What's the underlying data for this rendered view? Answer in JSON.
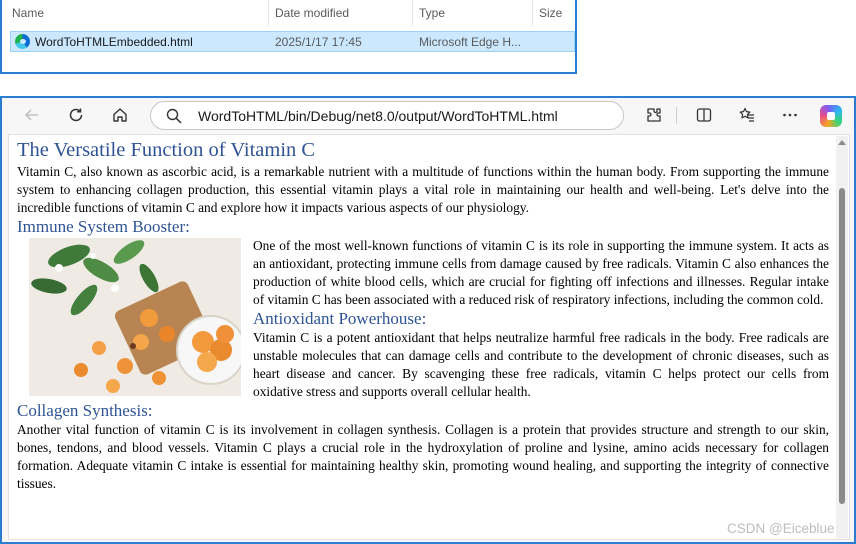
{
  "explorer": {
    "columns": {
      "name": "Name",
      "date": "Date modified",
      "type": "Type",
      "size": "Size"
    },
    "file": {
      "name": "WordToHTMLEmbedded.html",
      "date": "2025/1/17 17:45",
      "type": "Microsoft Edge H..."
    }
  },
  "browser": {
    "url": "WordToHTML/bin/Debug/net8.0/output/WordToHTML.html",
    "icons": [
      "back-icon",
      "refresh-icon",
      "home-icon",
      "search-icon",
      "extensions-icon",
      "split-screen-icon",
      "favorites-icon",
      "more-icon",
      "copilot-icon"
    ]
  },
  "doc": {
    "title": "The Versatile Function of Vitamin C",
    "intro": "Vitamin C, also known as ascorbic acid, is a remarkable nutrient with a multitude of functions within the human body. From supporting the immune system to enhancing collagen production, this essential vitamin plays a vital role in maintaining our health and well-being. Let's delve into the incredible functions of vitamin C and explore how it impacts various aspects of our physiology.",
    "h_immune": "Immune System Booster:",
    "p_immune": "One of the most well-known functions of vitamin C is its role in supporting the immune system. It acts as an antioxidant, protecting immune cells from damage caused by free radicals. Vitamin C also enhances the production of white blood cells, which are crucial for fighting off infections and illnesses. Regular intake of vitamin C has been associated with a reduced risk of respiratory infections, including the common cold.",
    "h_antioxidant": "Antioxidant Powerhouse:",
    "p_antioxidant": "Vitamin C is a potent antioxidant that helps neutralize harmful free radicals in the body. Free radicals are unstable molecules that can damage cells and contribute to the development of chronic diseases, such as heart disease and cancer. By scavenging these free radicals, vitamin C helps protect our cells from oxidative stress and supports overall cellular health.",
    "h_collagen": "Collagen Synthesis:",
    "p_collagen": "Another vital function of vitamin C is its involvement in collagen synthesis. Collagen is a protein that provides structure and strength to our skin, bones, tendons, and blood vessels. Vitamin C plays a crucial role in the hydroxylation of proline and lysine, amino acids necessary for collagen formation. Adequate vitamin C intake is essential for maintaining healthy skin, promoting wound healing, and supporting the integrity of connective tissues."
  },
  "watermark": "CSDN @Eiceblue",
  "colors": {
    "accent": "#2b7cd3",
    "heading": "#2f5496",
    "selection": "#cce8ff"
  }
}
